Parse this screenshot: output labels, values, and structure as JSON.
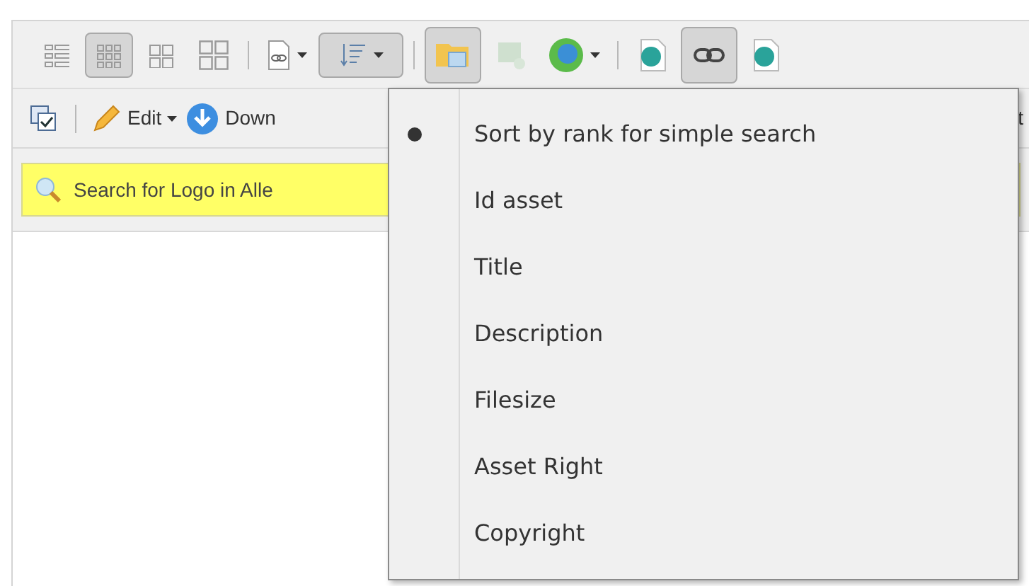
{
  "toolbar_1": {
    "view_buttons": [
      {
        "selected": false
      },
      {
        "selected": true
      },
      {
        "selected": false
      },
      {
        "selected": false
      }
    ],
    "sort_open": true,
    "folder_pressed": true,
    "link_pressed": true
  },
  "toolbar_2": {
    "edit": "Edit",
    "download": "Down",
    "cut_off": "t"
  },
  "search_banner": "Search for Logo in Alle",
  "sort_menu": [
    {
      "label": "Sort by rank for simple search",
      "selected": true
    },
    {
      "label": "Id asset",
      "selected": false
    },
    {
      "label": "Title",
      "selected": false
    },
    {
      "label": "Description",
      "selected": false
    },
    {
      "label": "Filesize",
      "selected": false
    },
    {
      "label": "Asset Right",
      "selected": false
    },
    {
      "label": "Copyright",
      "selected": false
    }
  ]
}
